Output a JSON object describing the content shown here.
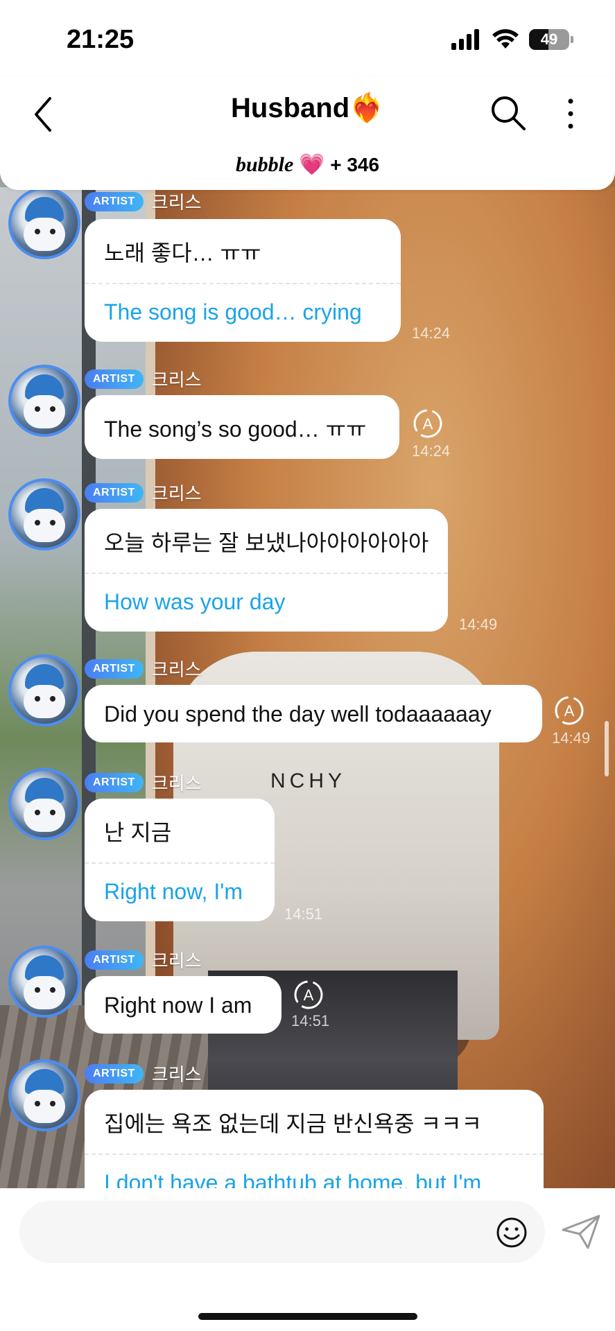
{
  "status_bar": {
    "time": "21:25",
    "battery": "49"
  },
  "header": {
    "title": "Husband",
    "title_emoji": "❤️‍🔥",
    "brand": "bubble",
    "brand_heart": "💗",
    "follower_count": "+ 346"
  },
  "messages": [
    {
      "badge": "ARTIST",
      "sender": "크리스",
      "original": "노래 좋다… ㅠㅠ",
      "translation": "The song is good… crying",
      "time": "14:24",
      "has_translate_icon": false
    },
    {
      "badge": "ARTIST",
      "sender": "크리스",
      "original": "The song’s so good… ㅠㅠ",
      "translation": null,
      "time": "14:24",
      "has_translate_icon": true
    },
    {
      "badge": "ARTIST",
      "sender": "크리스",
      "original": "오늘 하루는 잘 보냈나아아아아아아",
      "translation": "How was your day",
      "time": "14:49",
      "has_translate_icon": false
    },
    {
      "badge": "ARTIST",
      "sender": "크리스",
      "original": "Did you spend the day well todaaaaaay",
      "translation": null,
      "time": "14:49",
      "has_translate_icon": true
    },
    {
      "badge": "ARTIST",
      "sender": "크리스",
      "original": "난 지금",
      "translation": "Right now, I'm",
      "time": "14:51",
      "has_translate_icon": false
    },
    {
      "badge": "ARTIST",
      "sender": "크리스",
      "original": "Right now I am",
      "translation": null,
      "time": "14:51",
      "has_translate_icon": true
    },
    {
      "badge": "ARTIST",
      "sender": "크리스",
      "original": "집에는 욕조 없는데 지금 반신욕중 ㅋㅋㅋ",
      "translation": "I don't have a bathtub at home, but I'm",
      "time": "",
      "has_translate_icon": false
    }
  ],
  "background": {
    "shirt_text": "NCHY"
  },
  "input": {
    "placeholder": ""
  },
  "colors": {
    "accent_blue": "#4b7ef2",
    "translation_text": "#1aa3e8",
    "brand_pink": "#ef6fb0"
  }
}
